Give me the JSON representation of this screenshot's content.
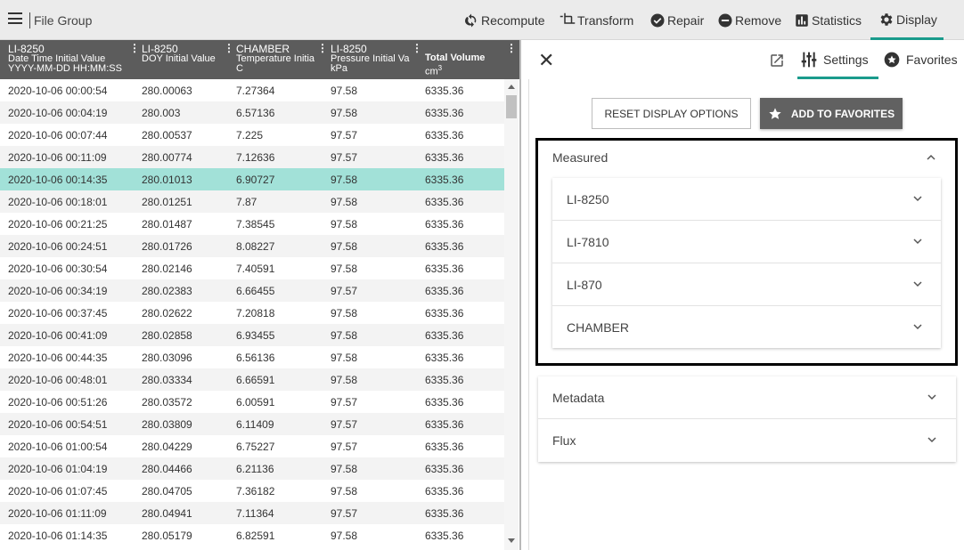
{
  "toolbar": {
    "file_group": "File Group",
    "actions": {
      "recompute": "Recompute",
      "transform": "Transform",
      "repair": "Repair",
      "remove": "Remove",
      "statistics": "Statistics",
      "display": "Display"
    },
    "active_action": "Display",
    "accent_color": "#1a9b8c"
  },
  "grid": {
    "columns": [
      {
        "line1": "LI-8250",
        "line2": "Date Time Initial Value",
        "line3": "YYYY-MM-DD HH:MM:SS"
      },
      {
        "line1": "LI-8250",
        "line2": "DOY Initial Value",
        "line3": ""
      },
      {
        "line1": "CHAMBER",
        "line2": "Temperature Initia",
        "line3": "C"
      },
      {
        "line1": "LI-8250",
        "line2": "Pressure Initial Va",
        "line3": "kPa"
      },
      {
        "line1": "",
        "line2": "Total Volume",
        "line3": "cm",
        "sup": "3"
      }
    ],
    "selected_row_index": 4,
    "selected_color": "#a2e1d8",
    "rows": [
      [
        "2020-10-06 00:00:54",
        "280.00063",
        "7.27364",
        "97.58",
        "6335.36"
      ],
      [
        "2020-10-06 00:04:19",
        "280.003",
        "6.57136",
        "97.58",
        "6335.36"
      ],
      [
        "2020-10-06 00:07:44",
        "280.00537",
        "7.225",
        "97.57",
        "6335.36"
      ],
      [
        "2020-10-06 00:11:09",
        "280.00774",
        "7.12636",
        "97.57",
        "6335.36"
      ],
      [
        "2020-10-06 00:14:35",
        "280.01013",
        "6.90727",
        "97.58",
        "6335.36"
      ],
      [
        "2020-10-06 00:18:01",
        "280.01251",
        "7.87",
        "97.58",
        "6335.36"
      ],
      [
        "2020-10-06 00:21:25",
        "280.01487",
        "7.38545",
        "97.58",
        "6335.36"
      ],
      [
        "2020-10-06 00:24:51",
        "280.01726",
        "8.08227",
        "97.58",
        "6335.36"
      ],
      [
        "2020-10-06 00:30:54",
        "280.02146",
        "7.40591",
        "97.58",
        "6335.36"
      ],
      [
        "2020-10-06 00:34:19",
        "280.02383",
        "6.66455",
        "97.57",
        "6335.36"
      ],
      [
        "2020-10-06 00:37:45",
        "280.02622",
        "7.20818",
        "97.58",
        "6335.36"
      ],
      [
        "2020-10-06 00:41:09",
        "280.02858",
        "6.93455",
        "97.58",
        "6335.36"
      ],
      [
        "2020-10-06 00:44:35",
        "280.03096",
        "6.56136",
        "97.58",
        "6335.36"
      ],
      [
        "2020-10-06 00:48:01",
        "280.03334",
        "6.66591",
        "97.58",
        "6335.36"
      ],
      [
        "2020-10-06 00:51:26",
        "280.03572",
        "6.00591",
        "97.57",
        "6335.36"
      ],
      [
        "2020-10-06 00:54:51",
        "280.03809",
        "6.11409",
        "97.57",
        "6335.36"
      ],
      [
        "2020-10-06 01:00:54",
        "280.04229",
        "6.75227",
        "97.57",
        "6335.36"
      ],
      [
        "2020-10-06 01:04:19",
        "280.04466",
        "6.21136",
        "97.58",
        "6335.36"
      ],
      [
        "2020-10-06 01:07:45",
        "280.04705",
        "7.36182",
        "97.58",
        "6335.36"
      ],
      [
        "2020-10-06 01:11:09",
        "280.04941",
        "7.11364",
        "97.57",
        "6335.36"
      ],
      [
        "2020-10-06 01:14:35",
        "280.05179",
        "6.82591",
        "97.58",
        "6335.36"
      ]
    ]
  },
  "panel": {
    "tabs": {
      "settings": "Settings",
      "favorites": "Favorites"
    },
    "active_tab": "Settings",
    "reset_label": "RESET DISPLAY OPTIONS",
    "favorites_label": "ADD TO FAVORITES",
    "measured": {
      "label": "Measured",
      "items": [
        "LI-8250",
        "LI-7810",
        "LI-870",
        "CHAMBER"
      ]
    },
    "sections": [
      "Metadata",
      "Flux"
    ]
  }
}
